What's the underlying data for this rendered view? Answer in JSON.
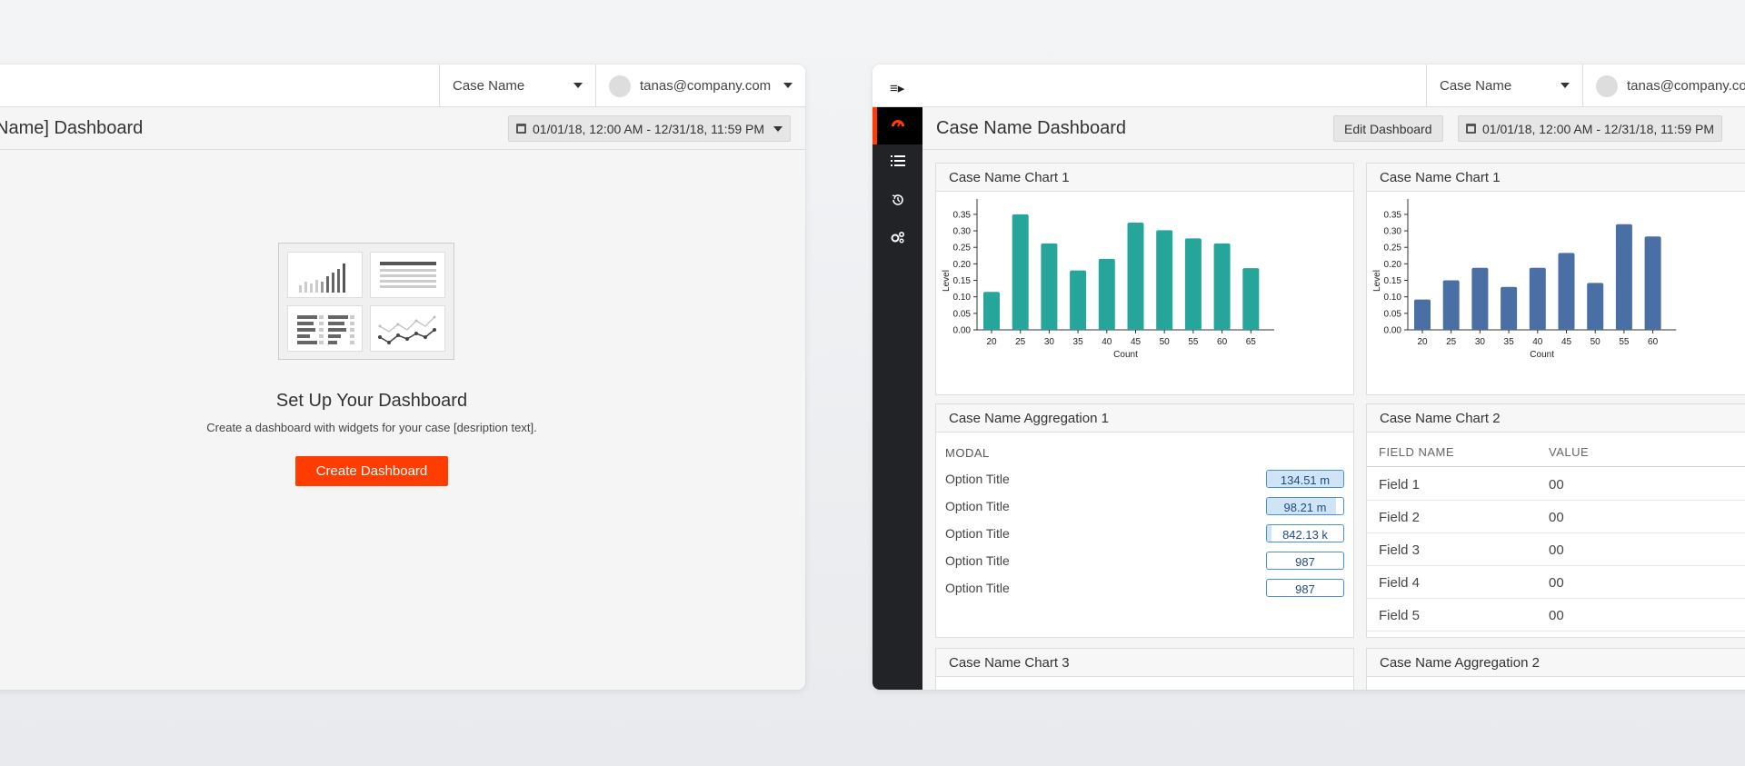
{
  "left_window": {
    "topbar": {
      "case_select": "Case Name",
      "user_email": "tanas@company.com"
    },
    "page_title": "Name] Dashboard",
    "date_range": "01/01/18, 12:00 AM - 12/31/18, 11:59 PM",
    "empty_state": {
      "title": "Set Up Your Dashboard",
      "description": "Create a dashboard with widgets for your case [desription text].",
      "button_label": "Create Dashboard"
    }
  },
  "right_window": {
    "topbar": {
      "case_select": "Case Name",
      "user_email": "tanas@company.com"
    },
    "sidebar": {
      "items": [
        {
          "icon": "speedometer-icon",
          "active": true
        },
        {
          "icon": "list-icon",
          "active": false
        },
        {
          "icon": "history-icon",
          "active": false
        },
        {
          "icon": "settings-gears-icon",
          "active": false
        }
      ]
    },
    "page_title": "Case Name Dashboard",
    "edit_button": "Edit Dashboard",
    "date_range": "01/01/18, 12:00 AM - 12/31/18, 11:59 PM",
    "panels": {
      "chart1_title": "Case Name Chart 1",
      "chart1b_title": "Case Name Chart 1",
      "agg1_title": "Case Name Aggregation 1",
      "chart2_title": "Case Name Chart 2",
      "chart3_title": "Case Name Chart 3",
      "agg2_title": "Case Name Aggregation 2"
    },
    "aggregation": {
      "section_label": "MODAL",
      "rows": [
        {
          "name": "Option Title",
          "value": "134.51 m",
          "fill": 1.0
        },
        {
          "name": "Option Title",
          "value": "98.21 m",
          "fill": 0.9
        },
        {
          "name": "Option Title",
          "value": "842.13 k",
          "fill": 0.06
        },
        {
          "name": "Option Title",
          "value": "987",
          "fill": 0.0
        },
        {
          "name": "Option Title",
          "value": "987",
          "fill": 0.0
        }
      ]
    },
    "table": {
      "columns": [
        "FIELD NAME",
        "VALUE"
      ],
      "rows": [
        [
          "Field 1",
          "00"
        ],
        [
          "Field 2",
          "00"
        ],
        [
          "Field 3",
          "00"
        ],
        [
          "Field 4",
          "00"
        ],
        [
          "Field 5",
          "00"
        ]
      ]
    }
  },
  "colors": {
    "accent": "#ff3d00",
    "teal": "#26a69a",
    "blue": "#4a6fa5",
    "sidebar": "#222327"
  },
  "chart_data": [
    {
      "type": "bar",
      "title": "Case Name Chart 1",
      "xlabel": "Count",
      "ylabel": "Level",
      "categories": [
        "20",
        "25",
        "30",
        "35",
        "40",
        "45",
        "50",
        "55",
        "60",
        "65"
      ],
      "values": [
        0.115,
        0.35,
        0.262,
        0.18,
        0.215,
        0.325,
        0.302,
        0.277,
        0.262,
        0.187
      ],
      "yticks": [
        "0.00",
        "0.05",
        "0.10",
        "0.15",
        "0.20",
        "0.25",
        "0.30",
        "0.35"
      ],
      "ylim": [
        0,
        0.38
      ],
      "color": "#26a69a"
    },
    {
      "type": "bar",
      "title": "Case Name Chart 1",
      "xlabel": "Count",
      "ylabel": "Level",
      "categories": [
        "20",
        "25",
        "30",
        "35",
        "40",
        "45",
        "50",
        "55",
        "60"
      ],
      "values": [
        0.092,
        0.15,
        0.188,
        0.13,
        0.188,
        0.233,
        0.142,
        0.32,
        0.283
      ],
      "yticks": [
        "0.00",
        "0.05",
        "0.10",
        "0.15",
        "0.20",
        "0.25",
        "0.30",
        "0.35"
      ],
      "ylim": [
        0,
        0.38
      ],
      "color": "#4a6fa5"
    }
  ]
}
